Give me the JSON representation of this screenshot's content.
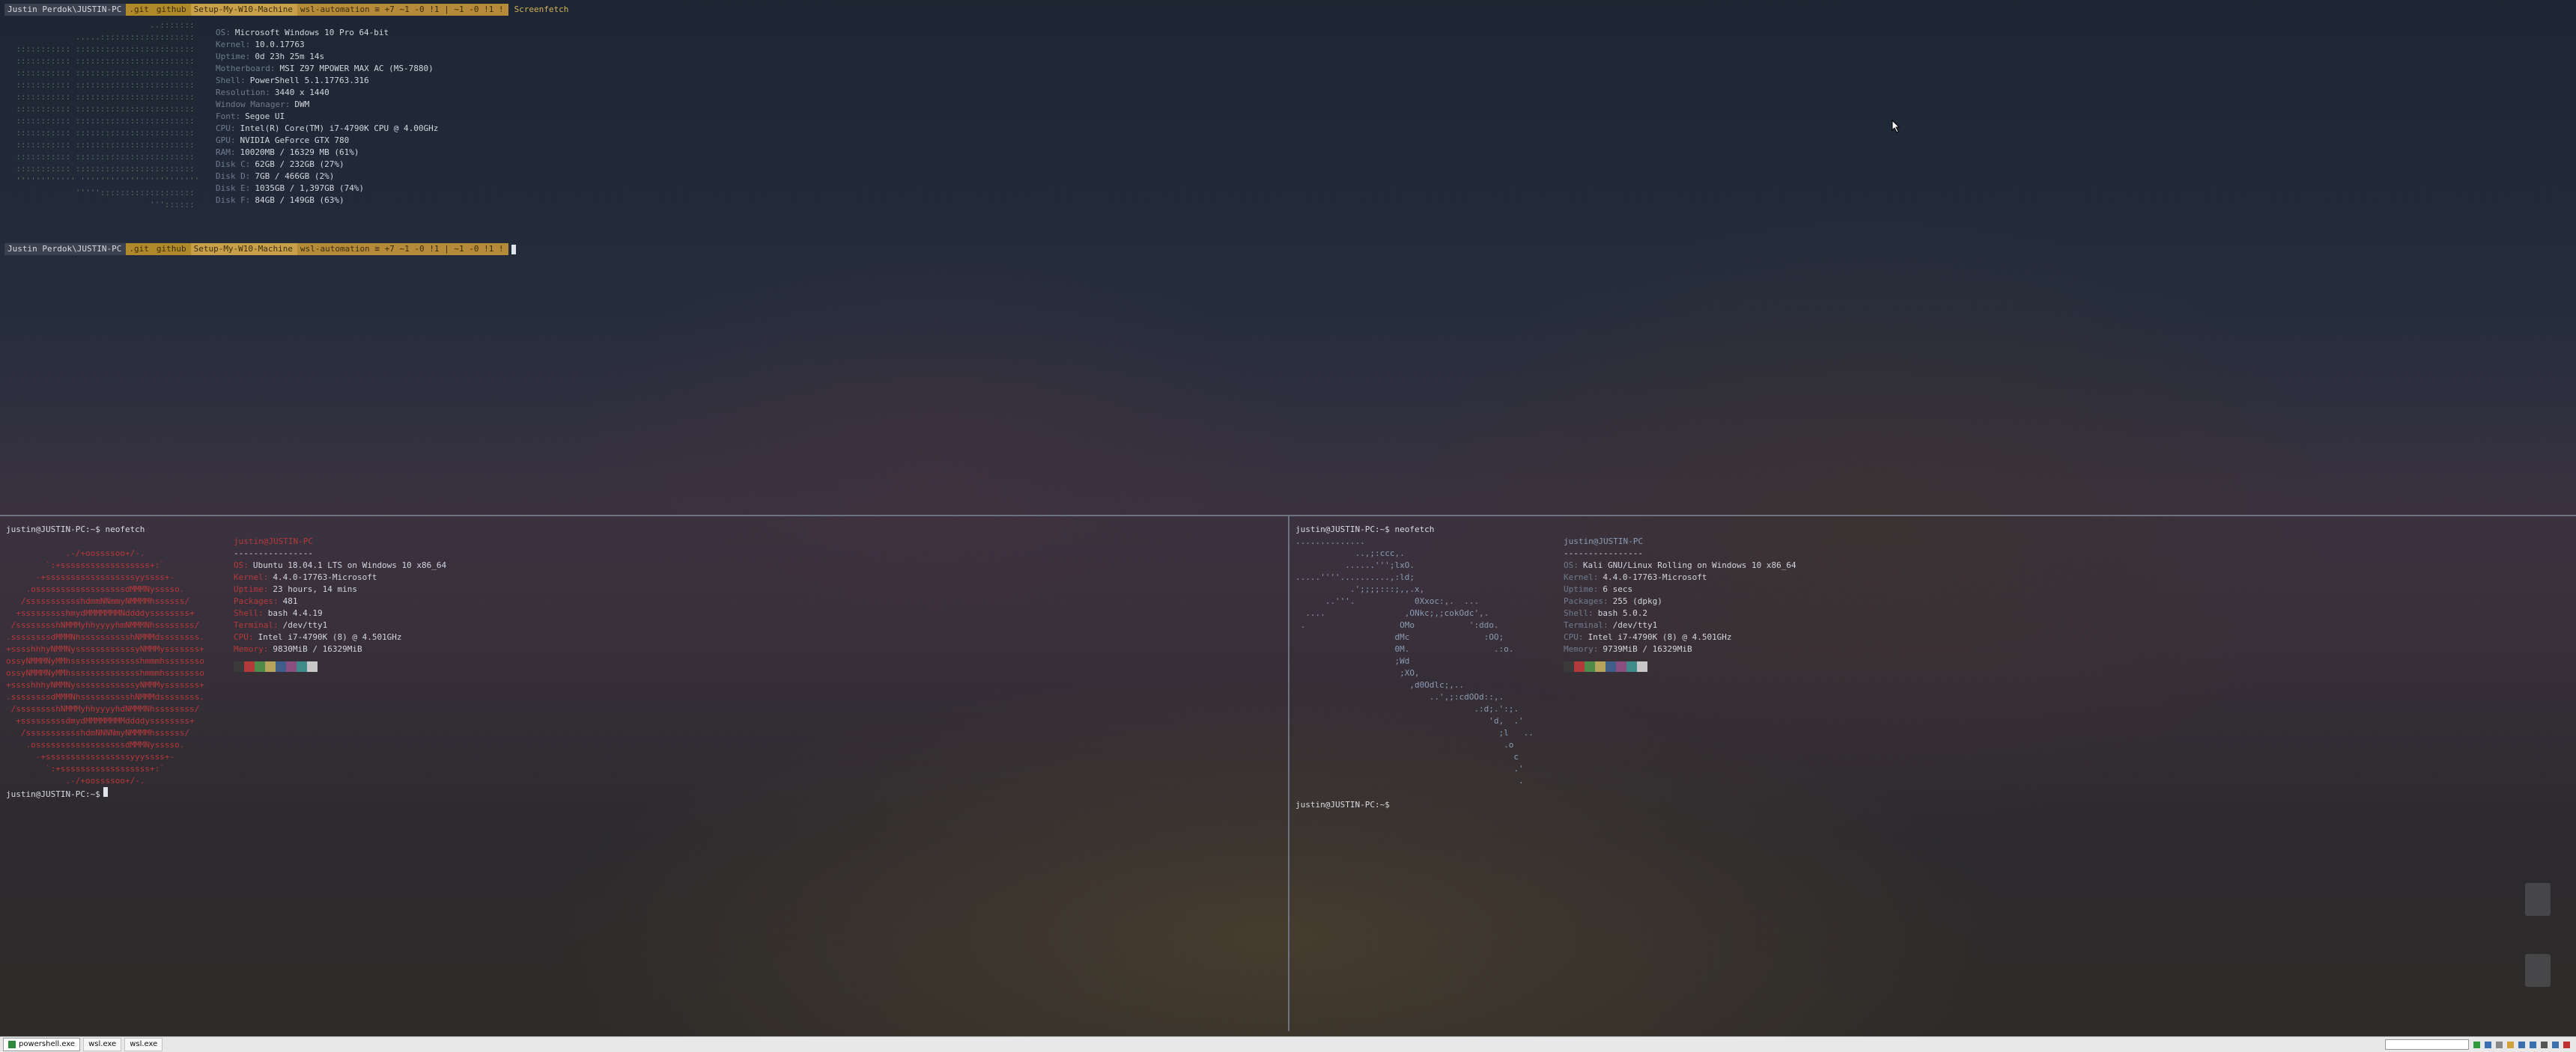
{
  "top": {
    "prompt1": {
      "user": "Justin Perdok\\JUSTIN-PC",
      "git": ".git",
      "p1": "github",
      "p2": "Setup-My-W10-Machine",
      "branch": "wsl-automation ≡ +7 ~1 -0 !1 | ~1 -0 !1 !",
      "command": "Screenfetch"
    },
    "prompt2": {
      "user": "Justin Perdok\\JUSTIN-PC",
      "git": ".git",
      "p1": "github",
      "p2": "Setup-My-W10-Machine",
      "branch": "wsl-automation ≡ +7 ~1 -0 !1 | ~1 -0 !1 !"
    },
    "art": "                             ..:::::::\n              .....:::::::::::::::::::\n  ::::::::::: ::::::::::::::::::::::::\n  ::::::::::: ::::::::::::::::::::::::\n  ::::::::::: ::::::::::::::::::::::::\n  ::::::::::: ::::::::::::::::::::::::\n  ::::::::::: ::::::::::::::::::::::::\n  ::::::::::: ::::::::::::::::::::::::\n  ::::::::::: ::::::::::::::::::::::::\n  ::::::::::: ::::::::::::::::::::::::\n  ::::::::::: ::::::::::::::::::::::::\n  ::::::::::: ::::::::::::::::::::::::\n  ::::::::::: ::::::::::::::::::::::::\n  '''''''''''' ''''''''''''''''''''''''\n              ''''':::::::::::::::::::\n                             '''::::::",
    "info": [
      {
        "k": "OS:",
        "v": "Microsoft Windows 10 Pro 64-bit"
      },
      {
        "k": "Kernel:",
        "v": "10.0.17763"
      },
      {
        "k": "Uptime:",
        "v": "0d 23h 25m 14s"
      },
      {
        "k": "Motherboard:",
        "v": "MSI Z97 MPOWER MAX AC (MS-7880)"
      },
      {
        "k": "Shell:",
        "v": "PowerShell 5.1.17763.316"
      },
      {
        "k": "Resolution:",
        "v": "3440 x 1440"
      },
      {
        "k": "Window Manager:",
        "v": "DWM"
      },
      {
        "k": "Font:",
        "v": "Segoe UI"
      },
      {
        "k": "CPU:",
        "v": "Intel(R) Core(TM) i7-4790K CPU @ 4.00GHz"
      },
      {
        "k": "GPU:",
        "v": "NVIDIA GeForce GTX 780"
      },
      {
        "k": "RAM:",
        "v": "10020MB / 16329 MB (61%)"
      },
      {
        "k": "Disk C:",
        "v": "62GB / 232GB (27%)"
      },
      {
        "k": "Disk D:",
        "v": "7GB / 466GB (2%)"
      },
      {
        "k": "Disk E:",
        "v": "1035GB / 1,397GB (74%)"
      },
      {
        "k": "Disk F:",
        "v": "84GB / 149GB (63%)"
      }
    ]
  },
  "left": {
    "command_line": "justin@JUSTIN-PC:~$ neofetch",
    "title": "justin@JUSTIN-PC",
    "underline": "----------------",
    "art": "            .-/+oossssoo+/-.\n        `:+ssssssssssssssssss+:`\n      -+ssssssssssssssssssyyssss+-\n    .ossssssssssssssssssdMMMNysssso.\n   /ssssssssssshdmmNNmmyNMMMMhssssss/\n  +ssssssssshmydMMMMMMMNddddyssssssss+\n /sssssssshNMMMyhhyyyyhmNMMMNhssssssss/\n.ssssssssdMMMNhsssssssssshNMMMdssssssss.\n+sssshhhyNMMNyssssssssssssyNMMMysssssss+\nossyNMMMNyMMhsssssssssssssshmmmhssssssso\nossyNMMMNyMMhsssssssssssssshmmmhssssssso\n+sssshhhyNMMNyssssssssssssyNMMMysssssss+\n.ssssssssdMMMNhsssssssssshNMMMdssssssss.\n /sssssssshNMMMyhhyyyyhdNMMMNhssssssss/\n  +sssssssssdmydMMMMMMMMddddyssssssss+\n   /ssssssssssshdmNNNNmyNMMMMhssssss/\n    .ossssssssssssssssssdMMMNysssso.\n      -+sssssssssssssssssyyyssss+-\n        `:+ssssssssssssssssss+:`\n            .-/+oossssoo+/-.",
    "info": [
      {
        "k": "OS:",
        "v": "Ubuntu 18.04.1 LTS on Windows 10 x86_64"
      },
      {
        "k": "Kernel:",
        "v": "4.4.0-17763-Microsoft"
      },
      {
        "k": "Uptime:",
        "v": "23 hours, 14 mins"
      },
      {
        "k": "Packages:",
        "v": "481"
      },
      {
        "k": "Shell:",
        "v": "bash 4.4.19"
      },
      {
        "k": "Terminal:",
        "v": "/dev/tty1"
      },
      {
        "k": "CPU:",
        "v": "Intel i7-4790K (8) @ 4.501GHz"
      },
      {
        "k": "Memory:",
        "v": "9830MiB / 16329MiB"
      }
    ],
    "prompt_end": "justin@JUSTIN-PC:~$"
  },
  "right": {
    "command_line": "justin@JUSTIN-PC:~$ neofetch",
    "title": "justin@JUSTIN-PC",
    "underline": "----------------",
    "art": "..............\n            ..,;:ccc,.\n          ......''';lxO.\n.....''''..........,:ld;\n           .';;;;:::;,,.x,\n      ..'''.            0Xxoc:,.  ...\n  ....                ,ONkc;,;cokOdc',.\n .                   OMo           ':ddo.\n                    dMc               :OO;\n                    0M.                 .:o.\n                    ;Wd\n                     ;XO,\n                       ,d0Odlc;,..\n                           ..',;:cdOOd::,.\n                                    .:d;.':;.\n                                       'd,  .'\n                                         ;l   ..\n                                          .o\n                                            c\n                                            .'\n                                             .",
    "info": [
      {
        "k": "OS:",
        "v": "Kali GNU/Linux Rolling on Windows 10 x86_64"
      },
      {
        "k": "Kernel:",
        "v": "4.4.0-17763-Microsoft"
      },
      {
        "k": "Uptime:",
        "v": "6 secs"
      },
      {
        "k": "Packages:",
        "v": "255 (dpkg)"
      },
      {
        "k": "Shell:",
        "v": "bash 5.0.2"
      },
      {
        "k": "Terminal:",
        "v": "/dev/tty1"
      },
      {
        "k": "CPU:",
        "v": "Intel i7-4790K (8) @ 4.501GHz"
      },
      {
        "k": "Memory:",
        "v": "9739MiB / 16329MiB"
      }
    ],
    "prompt_end": "justin@JUSTIN-PC:~$"
  },
  "palette": [
    "#3a3a3a",
    "#b33a3a",
    "#4e8a4a",
    "#b8a35a",
    "#3f5f8a",
    "#8a4f7f",
    "#3f8a8a",
    "#c8c8c8"
  ],
  "taskbar": {
    "tasks": [
      "powershell.exe",
      "wsl.exe",
      "wsl.exe"
    ]
  }
}
